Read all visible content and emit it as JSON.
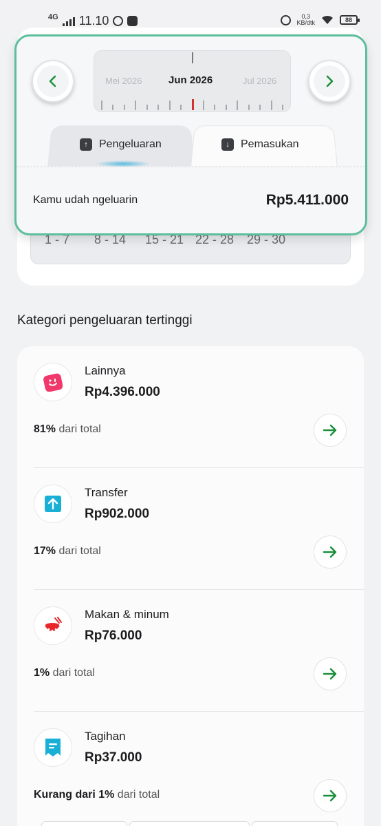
{
  "status_bar": {
    "network": "4G",
    "time": "11.10",
    "speed_value": "0,3",
    "speed_unit": "KB/dtk",
    "battery": "88"
  },
  "month_picker": {
    "prev_month": "Mei 2026",
    "current_month": "Jun 2026",
    "next_month": "Jul 2026"
  },
  "tabs": [
    {
      "label": "Pengeluaran",
      "icon": "arrow-up-square-icon",
      "active": true
    },
    {
      "label": "Pemasukan",
      "icon": "arrow-down-square-icon",
      "active": false
    }
  ],
  "summary": {
    "label": "Kamu udah ngeluarin",
    "value": "Rp5.411.000"
  },
  "weeks": [
    "1 - 7",
    "8 - 14",
    "15 - 21",
    "22 - 28",
    "29 - 30"
  ],
  "section_title": "Kategori pengeluaran tertinggi",
  "categories": [
    {
      "name": "Lainnya",
      "amount": "Rp4.396.000",
      "percent": "81%",
      "suffix": " dari total",
      "icon": "smiley-square-icon",
      "color": "#f0386b"
    },
    {
      "name": "Transfer",
      "amount": "Rp902.000",
      "percent": "17%",
      "suffix": " dari total",
      "icon": "arrow-up-box-icon",
      "color": "#1ab0d6"
    },
    {
      "name": "Makan & minum",
      "amount": "Rp76.000",
      "percent": "1%",
      "suffix": " dari total",
      "icon": "food-bowl-icon",
      "color": "#e8262b"
    },
    {
      "name": "Tagihan",
      "amount": "Rp37.000",
      "percent": "Kurang dari 1%",
      "suffix": " dari total",
      "icon": "bill-receipt-icon",
      "color": "#1ab0d6"
    }
  ],
  "colors": {
    "accent_green": "#1a8f3a",
    "header_border": "#5bbf9b",
    "indicator_red": "#d33333"
  }
}
